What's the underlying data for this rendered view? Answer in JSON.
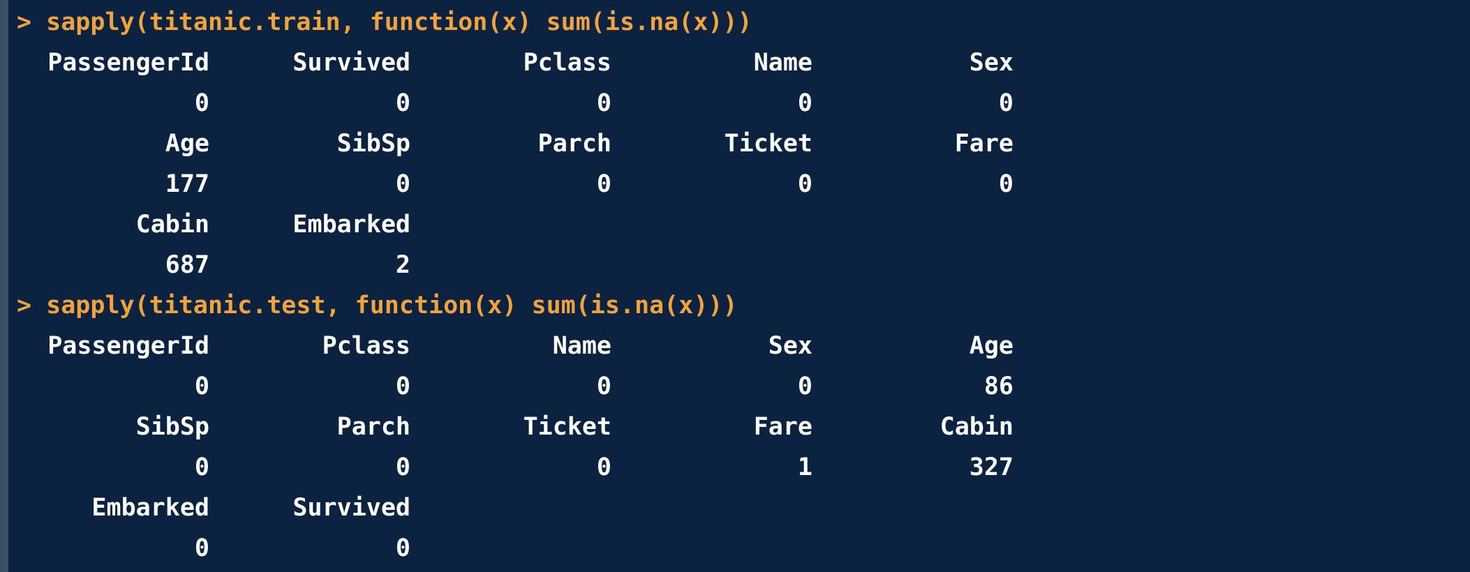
{
  "colors": {
    "background": "#0b2341",
    "command": "#f0a23d",
    "output": "#ffffff"
  },
  "blocks": [
    {
      "prompt": ">",
      "command": "sapply(titanic.train, function(x) sum(is.na(x)))",
      "rows": [
        [
          "PassengerId",
          "Survived",
          "Pclass",
          "Name",
          "Sex"
        ],
        [
          "0",
          "0",
          "0",
          "0",
          "0"
        ],
        [
          "Age",
          "SibSp",
          "Parch",
          "Ticket",
          "Fare"
        ],
        [
          "177",
          "0",
          "0",
          "0",
          "0"
        ],
        [
          "Cabin",
          "Embarked",
          "",
          "",
          ""
        ],
        [
          "687",
          "2",
          "",
          "",
          ""
        ]
      ]
    },
    {
      "prompt": ">",
      "command": "sapply(titanic.test, function(x) sum(is.na(x)))",
      "rows": [
        [
          "PassengerId",
          "Pclass",
          "Name",
          "Sex",
          "Age"
        ],
        [
          "0",
          "0",
          "0",
          "0",
          "86"
        ],
        [
          "SibSp",
          "Parch",
          "Ticket",
          "Fare",
          "Cabin"
        ],
        [
          "0",
          "0",
          "0",
          "1",
          "327"
        ],
        [
          "Embarked",
          "Survived",
          "",
          "",
          ""
        ],
        [
          "0",
          "0",
          "",
          "",
          ""
        ]
      ]
    }
  ]
}
